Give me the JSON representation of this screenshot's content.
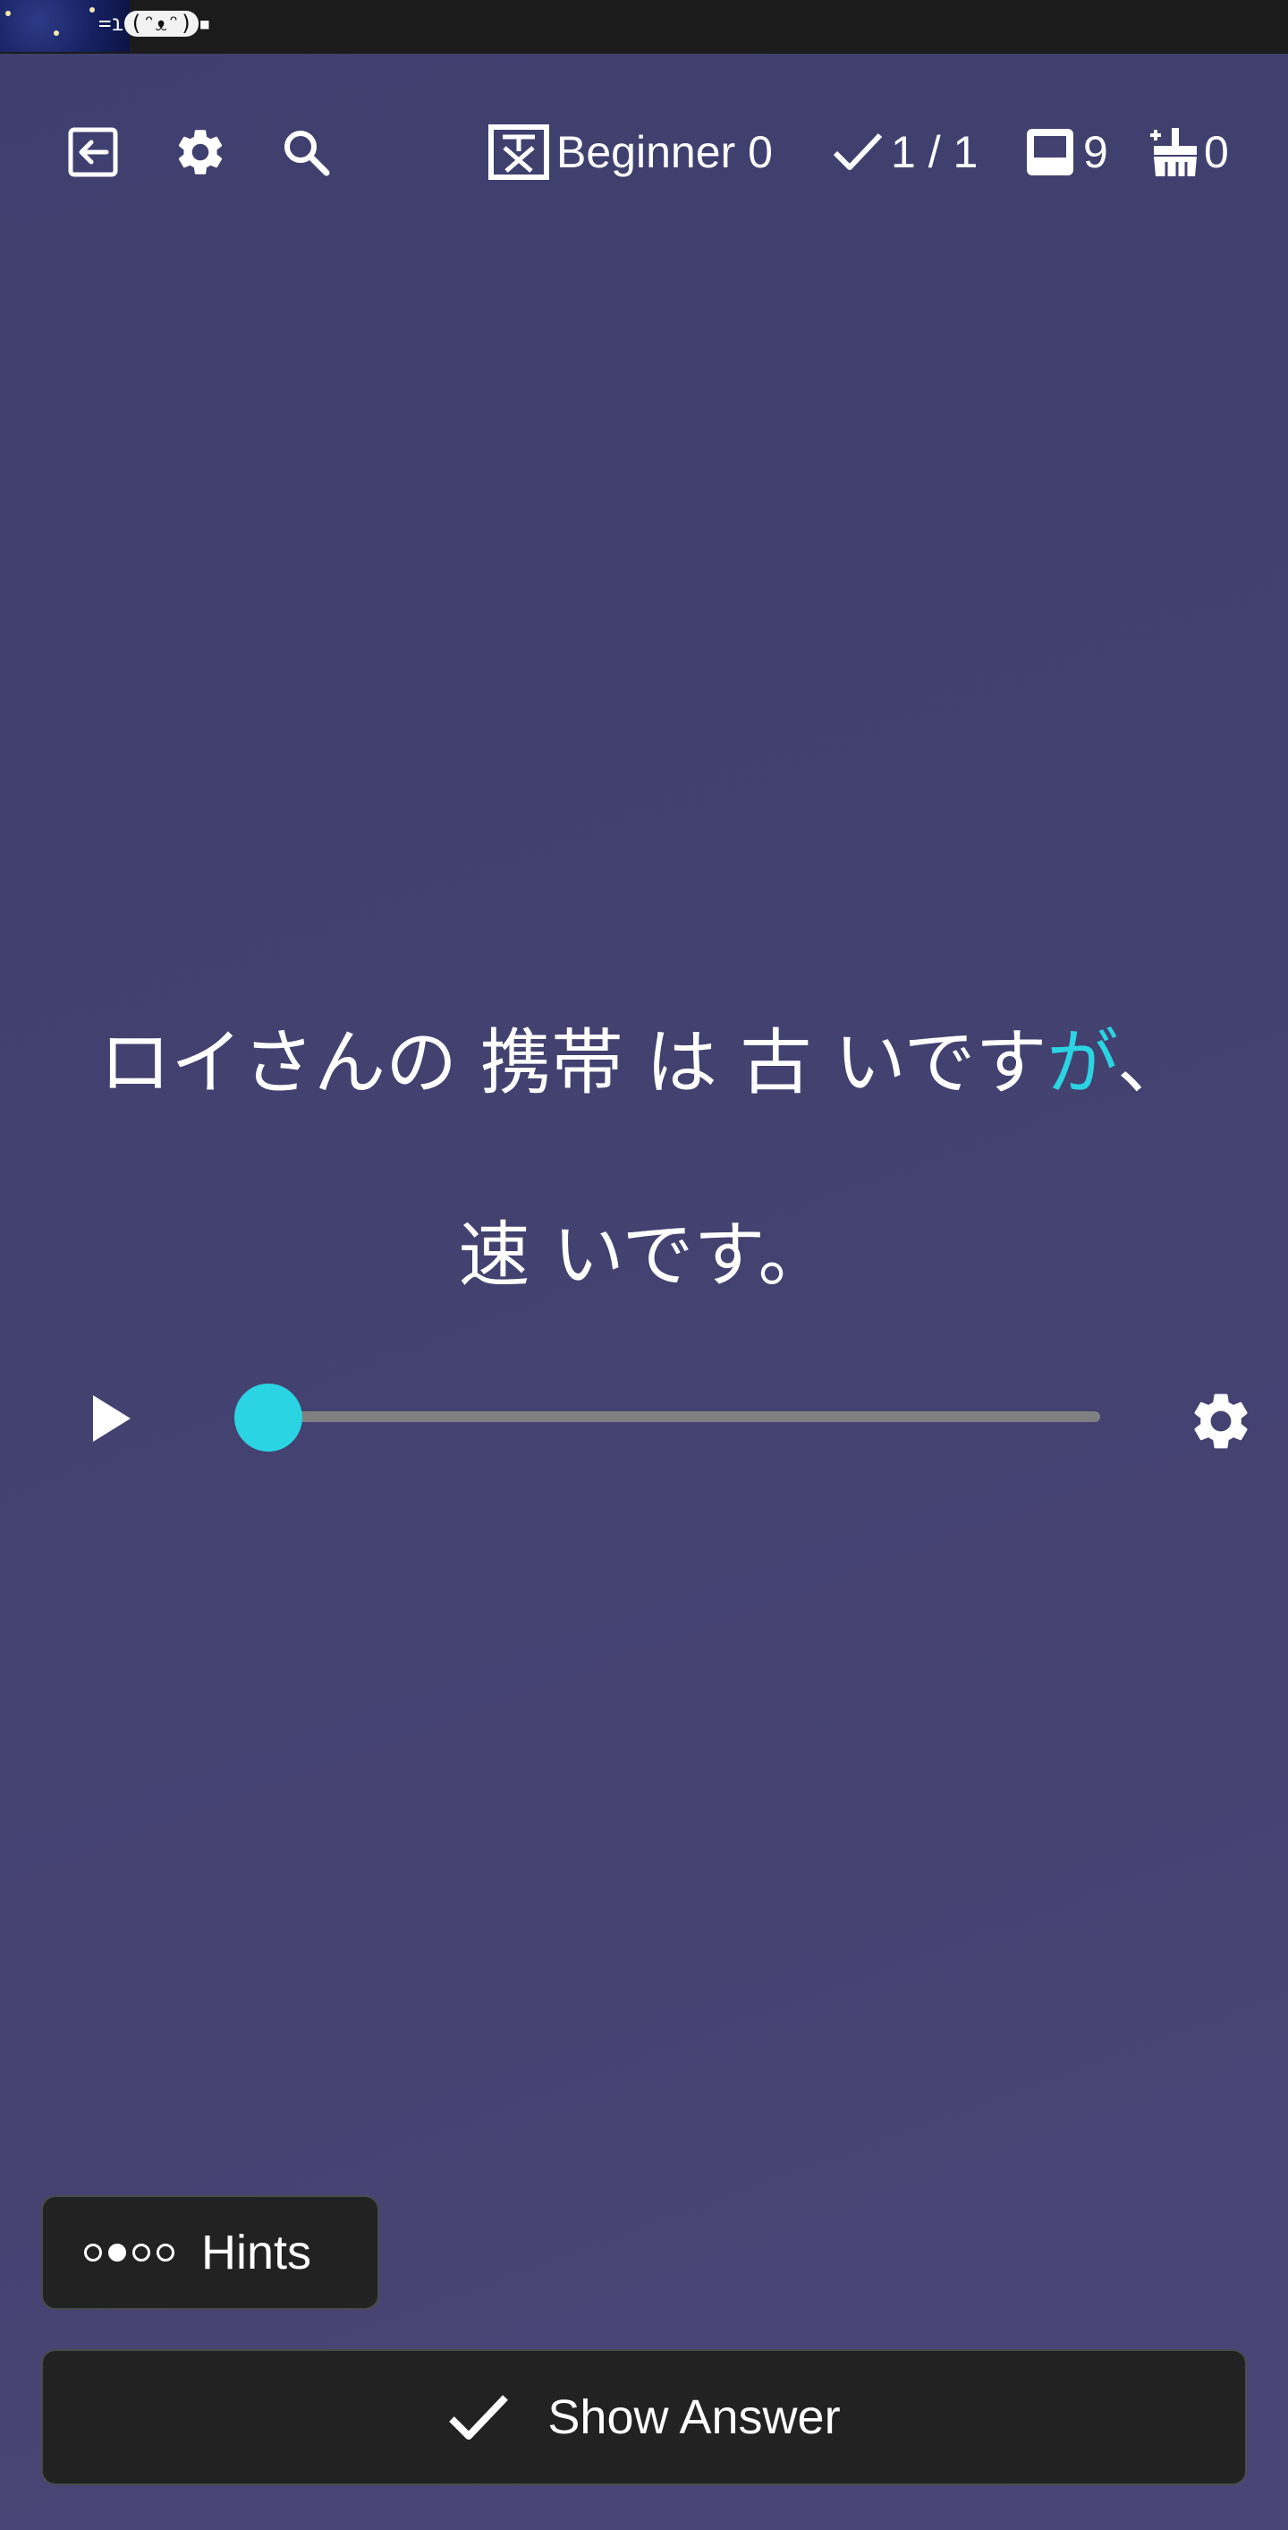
{
  "status_bar": {
    "kaomoji_left": "=ɿ",
    "kaomoji_face": "(ᵔᴥᵔ)",
    "kaomoji_right": "▪"
  },
  "toolbar": {
    "icons": [
      "exit-icon",
      "gear-icon",
      "search-icon"
    ],
    "level_label": "Beginner",
    "level_count": "0",
    "reviewed": "1 / 1",
    "inbox_count": "9",
    "clean_count": "0"
  },
  "card": {
    "line1_before": "ロイさんの 携帯 は 古 いです",
    "line1_highlight": "が",
    "line1_after": "、",
    "line2": "速 いです。"
  },
  "player": {
    "progress": 0
  },
  "buttons": {
    "hints_label": "Hints",
    "show_answer_label": "Show Answer"
  },
  "colors": {
    "accent": "#2bd4e2",
    "button_bg": "#222222",
    "background": "#42416f"
  }
}
